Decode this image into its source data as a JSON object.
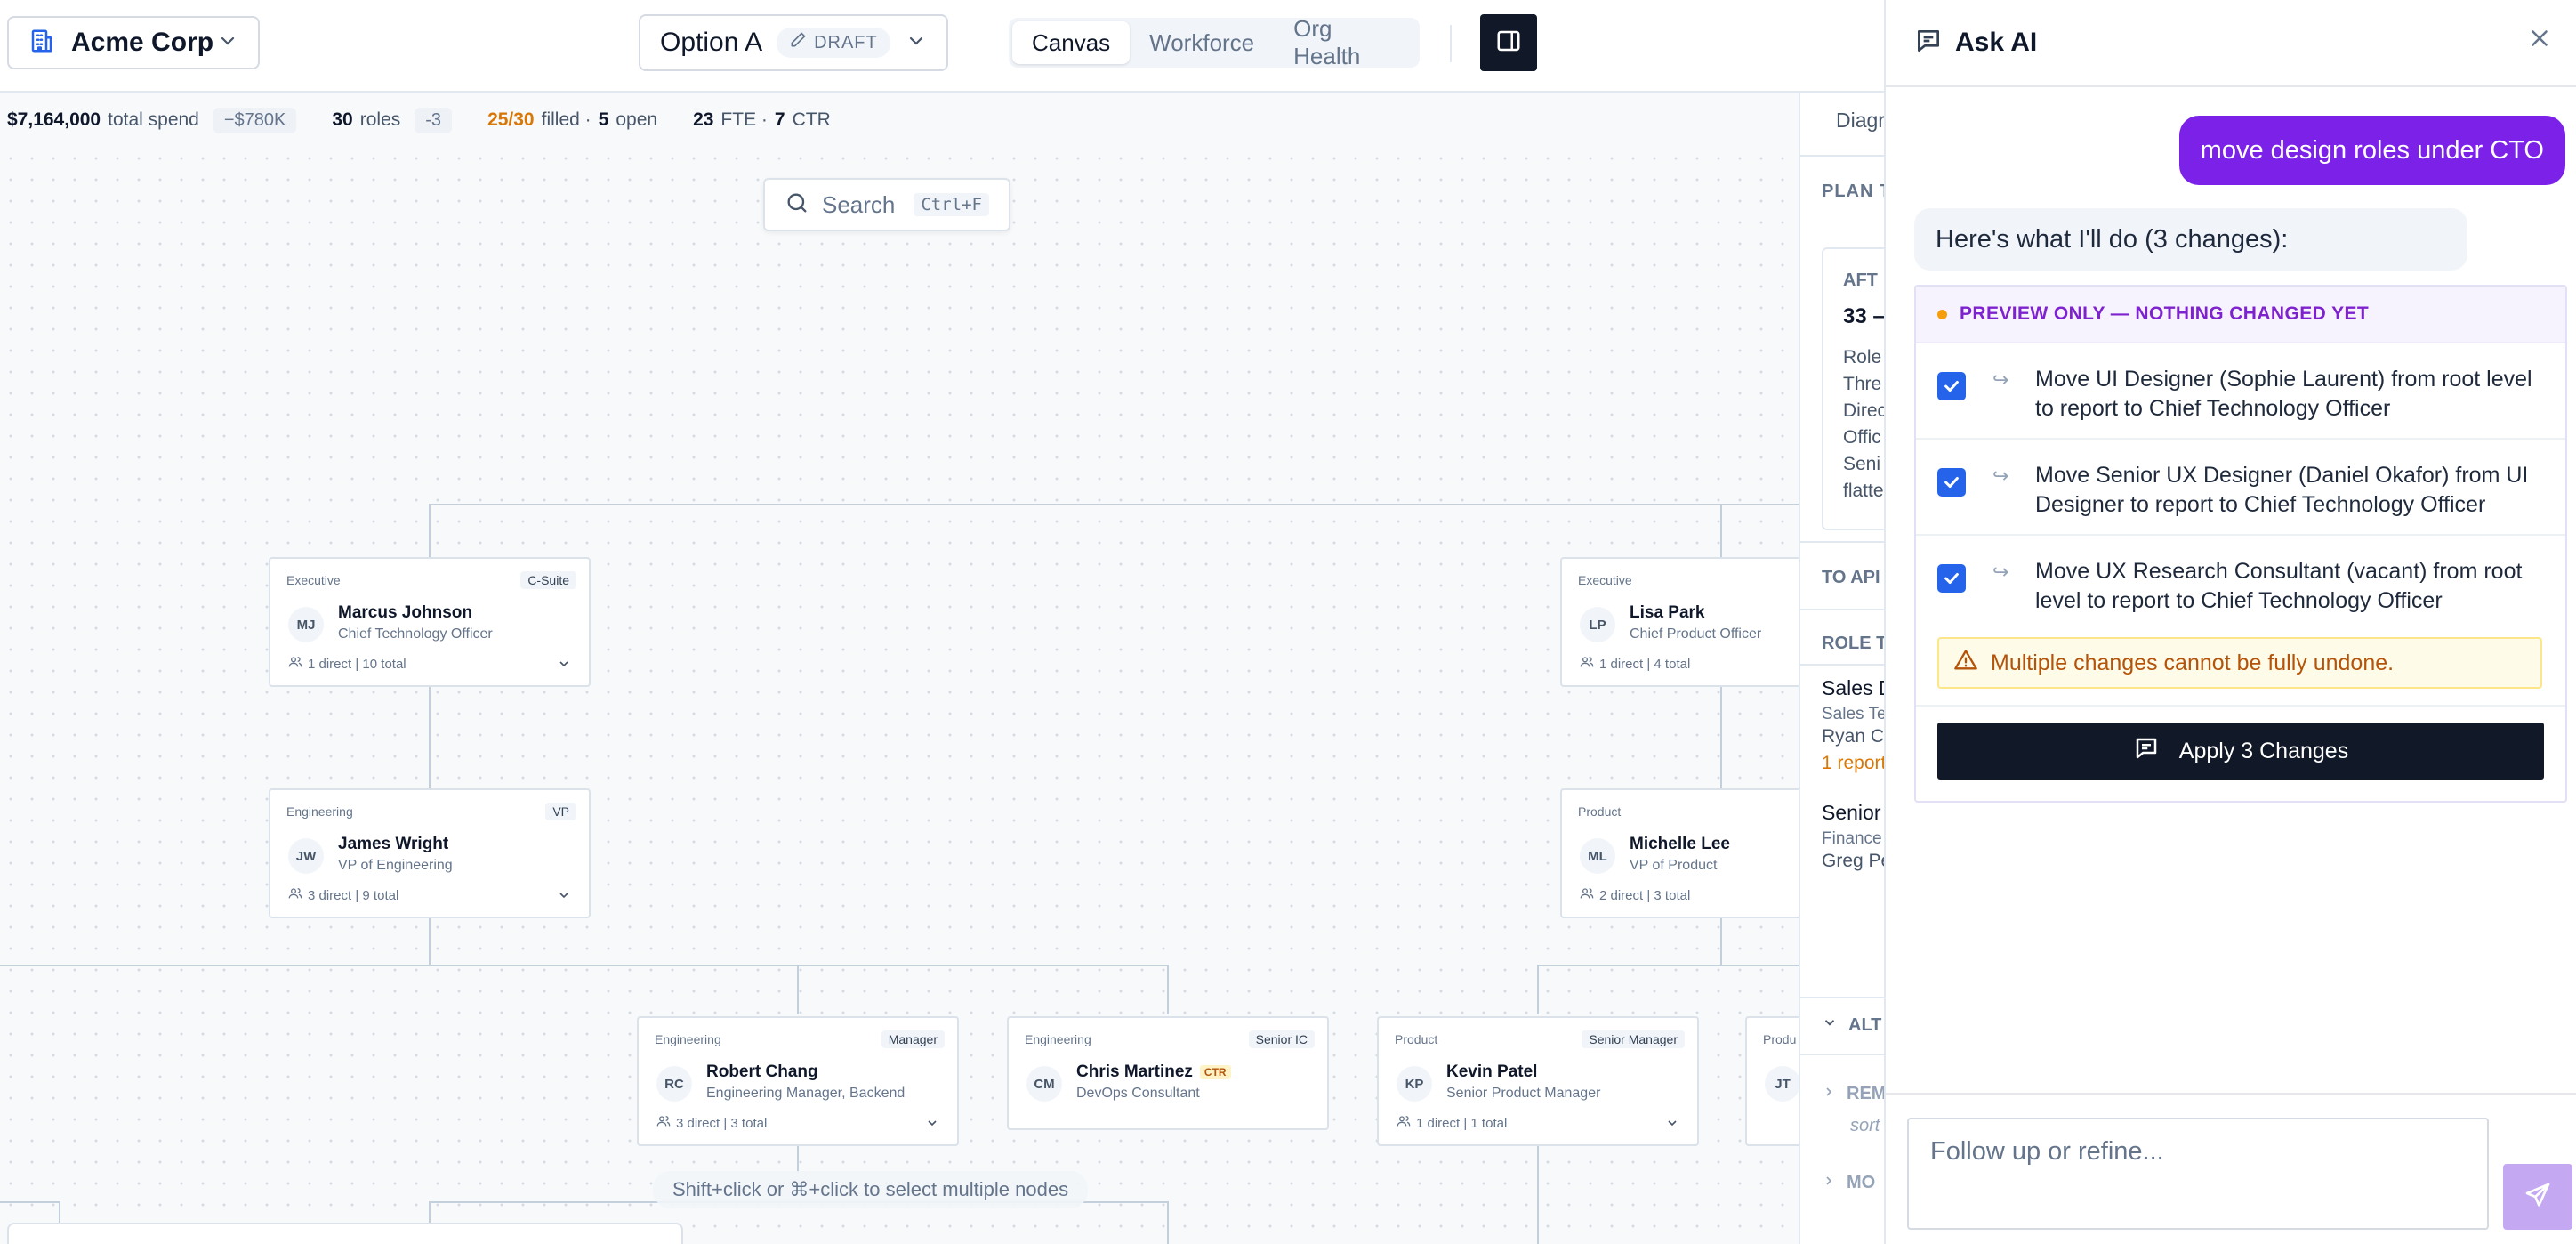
{
  "header": {
    "workspace": "Acme Corp",
    "option": "Option A",
    "draft_badge": "DRAFT",
    "tabs": [
      {
        "label": "Canvas",
        "active": true
      },
      {
        "label": "Workforce",
        "active": false
      },
      {
        "label": "Org Health",
        "active": false
      }
    ]
  },
  "stats": {
    "spend_value": "$7,164,000",
    "spend_label": "total spend",
    "spend_delta": "−$780K",
    "roles_value": "30",
    "roles_label": "roles",
    "roles_delta": "-3",
    "filled_value": "25/30",
    "filled_label": "filled ·",
    "open_value": "5",
    "open_label": "open",
    "fte_value": "23",
    "fte_label": "FTE ·",
    "ctr_value": "7",
    "ctr_label": "CTR"
  },
  "search": {
    "placeholder": "Search",
    "shortcut": "Ctrl+F"
  },
  "cards": {
    "marcus": {
      "dept": "Executive",
      "badge": "C-Suite",
      "initials": "MJ",
      "name": "Marcus Johnson",
      "role": "Chief Technology Officer",
      "reports": "1 direct | 10 total"
    },
    "lisa": {
      "dept": "Executive",
      "initials": "LP",
      "name": "Lisa Park",
      "role": "Chief Product Officer",
      "reports": "1 direct | 4 total"
    },
    "james": {
      "dept": "Engineering",
      "badge": "VP",
      "initials": "JW",
      "name": "James Wright",
      "role": "VP of Engineering",
      "reports": "3 direct | 9 total"
    },
    "michelle": {
      "dept": "Product",
      "initials": "ML",
      "name": "Michelle Lee",
      "role": "VP of Product",
      "reports": "2 direct | 3 total"
    },
    "robert": {
      "dept": "Engineering",
      "badge": "Manager",
      "initials": "RC",
      "name": "Robert Chang",
      "role": "Engineering Manager, Backend",
      "reports": "3 direct | 3 total"
    },
    "chris": {
      "dept": "Engineering",
      "badge": "Senior IC",
      "initials": "CM",
      "name": "Chris Martinez",
      "ctr": "CTR",
      "role": "DevOps Consultant"
    },
    "kevin": {
      "dept": "Product",
      "badge": "Senior Manager",
      "initials": "KP",
      "name": "Kevin Patel",
      "role": "Senior Product Manager",
      "reports": "1 direct | 1 total"
    },
    "jt": {
      "dept": "Produ",
      "initials": "JT"
    }
  },
  "canvas_hint": "Shift+click or ⌘+click to select multiple nodes",
  "side_panel": {
    "tab": "Diagr",
    "plan_label": "PLAN T",
    "after_label": "AFT",
    "after_value": "33 –",
    "after_lines": [
      "Role",
      "Thre",
      "Direc",
      "Offic",
      "Seni",
      "flatte"
    ],
    "to_apply": "TO API",
    "role_to": "ROLE TO",
    "item1_title": "Sales D",
    "item1_sub": "Sales Te",
    "item1_person": "Ryan Co",
    "item1_note": "1 report",
    "item2_title": "Senior",
    "item2_sub": "Finance",
    "item2_person": "Greg Pe",
    "alt_label": "ALT",
    "rem_label": "REM",
    "sort_label": "sort",
    "mo_label": "MO"
  },
  "ai": {
    "title": "Ask AI",
    "user_message": "move design roles under CTO",
    "assistant_message": "Here's what I'll do (3 changes):",
    "preview_banner": "PREVIEW ONLY — NOTHING CHANGED YET",
    "changes": [
      {
        "text": "Move UI Designer (Sophie Laurent) from root level to report to Chief Technology Officer",
        "checked": true
      },
      {
        "text": "Move Senior UX Designer (Daniel Okafor) from UI Designer to report to Chief Technology Officer",
        "checked": true
      },
      {
        "text": "Move UX Research Consultant (vacant) from root level to report to Chief Technology Officer",
        "checked": true
      }
    ],
    "warning": "Multiple changes cannot be fully undone.",
    "apply_label": "Apply 3 Changes",
    "composer_placeholder": "Follow up or refine..."
  },
  "icons": {
    "workspace": "building-icon",
    "draft": "pencil-icon",
    "panel_toggle": "sidebar-toggle-icon",
    "search": "search-icon",
    "ai_title": "chat-icon",
    "close": "close-icon",
    "warning": "warning-icon",
    "apply": "chat-icon",
    "send": "send-icon"
  },
  "colors": {
    "accent": "#7c22e8",
    "dark": "#111827",
    "warning": "#b45309",
    "checkbox": "#2563eb"
  }
}
